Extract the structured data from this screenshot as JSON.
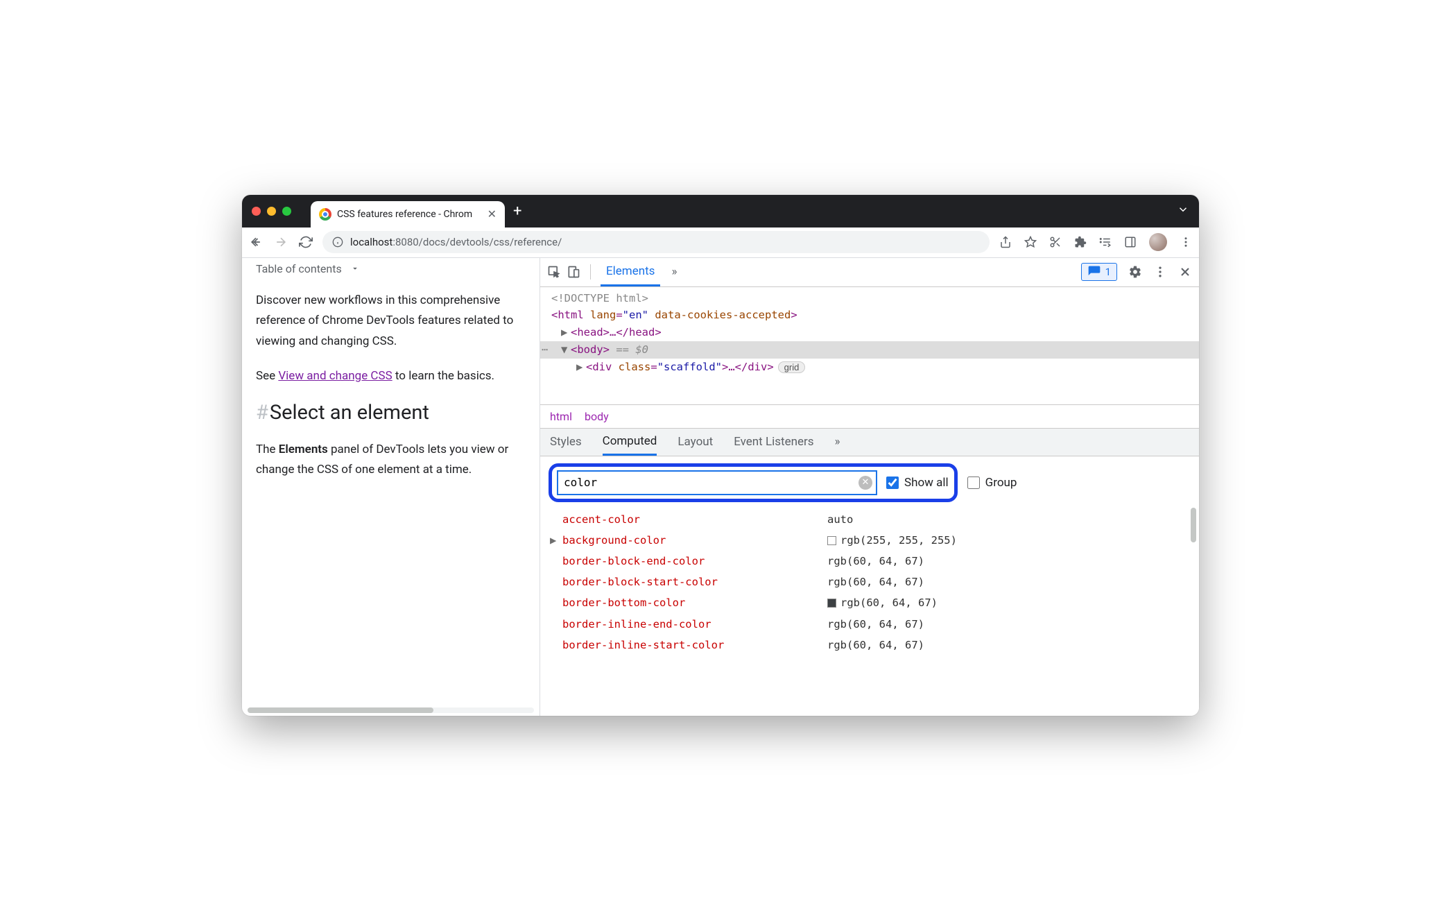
{
  "tab": {
    "title": "CSS features reference - Chrom"
  },
  "url": {
    "host": "localhost",
    "port_path": ":8080/docs/devtools/css/reference/"
  },
  "page": {
    "toc": "Table of contents",
    "para1": "Discover new workflows in this comprehensive reference of Chrome DevTools features related to viewing and changing CSS.",
    "para2_a": "See ",
    "para2_link": "View and change CSS",
    "para2_b": " to learn the basics.",
    "heading": "Select an element",
    "para3_a": "The ",
    "para3_strong": "Elements",
    "para3_b": " panel of DevTools lets you view or change the CSS of one element at a time."
  },
  "devtools": {
    "tabs": {
      "elements": "Elements",
      "more": "»"
    },
    "issues_count": "1",
    "dom": {
      "doctype": "<!DOCTYPE html>",
      "html_open": "<html ",
      "lang_attr": "lang",
      "lang_val": "\"en\"",
      "cookies_attr": "data-cookies-accepted",
      "html_close": ">",
      "head": "<head>…</head>",
      "body": "<body>",
      "eq0": " == $0",
      "div_open": "<div ",
      "class_attr": "class",
      "class_val": "\"scaffold\"",
      "div_close": ">…</div>",
      "grid_badge": "grid"
    },
    "breadcrumb": [
      "html",
      "body"
    ],
    "subtabs": {
      "styles": "Styles",
      "computed": "Computed",
      "layout": "Layout",
      "events": "Event Listeners",
      "more": "»"
    },
    "filter": {
      "value": "color",
      "show_all": "Show all",
      "group": "Group"
    },
    "computed": [
      {
        "prop": "accent-color",
        "val": "auto",
        "expandable": false,
        "swatch": null
      },
      {
        "prop": "background-color",
        "val": "rgb(255, 255, 255)",
        "expandable": true,
        "swatch": "#ffffff"
      },
      {
        "prop": "border-block-end-color",
        "val": "rgb(60, 64, 67)",
        "expandable": false,
        "swatch": null
      },
      {
        "prop": "border-block-start-color",
        "val": "rgb(60, 64, 67)",
        "expandable": false,
        "swatch": null
      },
      {
        "prop": "border-bottom-color",
        "val": "rgb(60, 64, 67)",
        "expandable": false,
        "swatch": "#3c4043"
      },
      {
        "prop": "border-inline-end-color",
        "val": "rgb(60, 64, 67)",
        "expandable": false,
        "swatch": null
      },
      {
        "prop": "border-inline-start-color",
        "val": "rgb(60, 64, 67)",
        "expandable": false,
        "swatch": null
      }
    ]
  }
}
